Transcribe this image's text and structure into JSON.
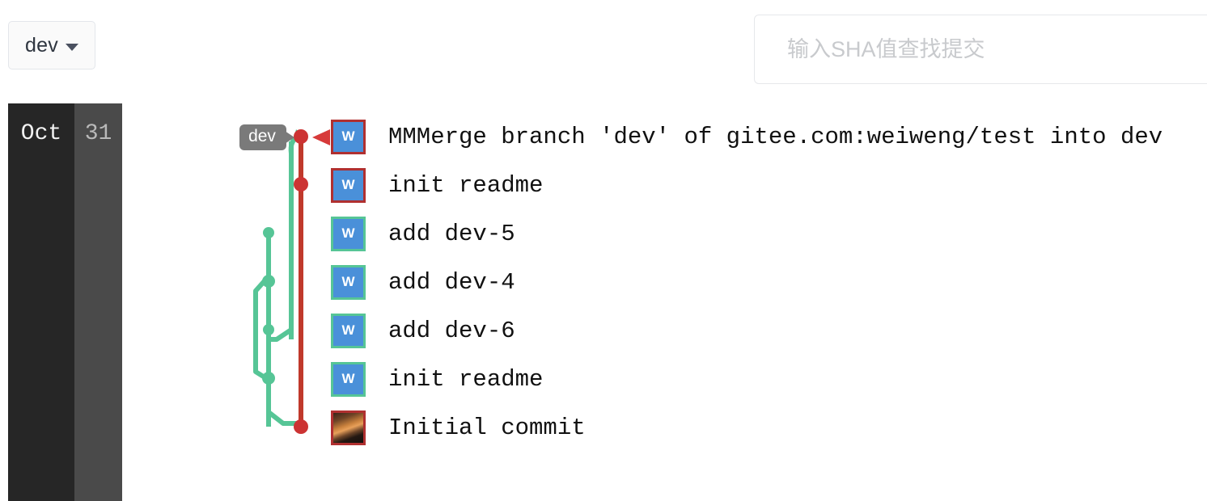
{
  "toolbar": {
    "branch_selector": {
      "label": "dev",
      "icon": "chevron-down-icon"
    },
    "sha_search": {
      "value": "",
      "placeholder": "输入SHA值查找提交"
    }
  },
  "date_gutter": {
    "month": "Oct",
    "day": "31"
  },
  "graph": {
    "branch_tag": {
      "label": "dev",
      "color": "#7a7a7a"
    },
    "head_marker": {
      "icon": "left-triangle-marker",
      "color": "#cc3333"
    },
    "colors": {
      "main_branch": "#c0392b",
      "feature_branch": "#56c596"
    }
  },
  "commits": [
    {
      "avatar_initial": "W",
      "avatar_style": "ring-red",
      "message": "MMMerge branch 'dev' of gitee.com:weiweng/test into dev"
    },
    {
      "avatar_initial": "W",
      "avatar_style": "ring-red",
      "message": "init readme"
    },
    {
      "avatar_initial": "W",
      "avatar_style": "ring-teal",
      "message": "add dev-5"
    },
    {
      "avatar_initial": "W",
      "avatar_style": "ring-teal",
      "message": "add dev-4"
    },
    {
      "avatar_initial": "W",
      "avatar_style": "ring-teal",
      "message": "add dev-6"
    },
    {
      "avatar_initial": "W",
      "avatar_style": "ring-teal",
      "message": "init readme"
    },
    {
      "avatar_initial": "",
      "avatar_style": "photo",
      "message": "Initial commit"
    }
  ]
}
